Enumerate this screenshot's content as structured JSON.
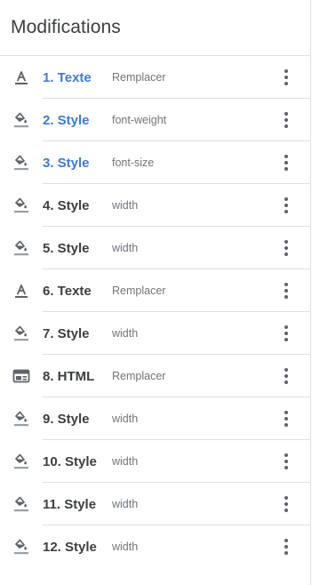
{
  "header": {
    "title": "Modifications"
  },
  "items": [
    {
      "label": "1. Texte",
      "detail": "Remplacer",
      "icon": "text-format-icon",
      "selected": true
    },
    {
      "label": "2. Style",
      "detail": "font-weight",
      "icon": "paint-bucket-icon",
      "selected": true
    },
    {
      "label": "3. Style",
      "detail": "font-size",
      "icon": "paint-bucket-icon",
      "selected": true
    },
    {
      "label": "4. Style",
      "detail": "width",
      "icon": "paint-bucket-icon",
      "selected": false
    },
    {
      "label": "5. Style",
      "detail": "width",
      "icon": "paint-bucket-icon",
      "selected": false
    },
    {
      "label": "6. Texte",
      "detail": "Remplacer",
      "icon": "text-format-icon",
      "selected": false
    },
    {
      "label": "7. Style",
      "detail": "width",
      "icon": "paint-bucket-icon",
      "selected": false
    },
    {
      "label": "8. HTML",
      "detail": "Remplacer",
      "icon": "html-block-icon",
      "selected": false
    },
    {
      "label": "9. Style",
      "detail": "width",
      "icon": "paint-bucket-icon",
      "selected": false
    },
    {
      "label": "10. Style",
      "detail": "width",
      "icon": "paint-bucket-icon",
      "selected": false
    },
    {
      "label": "11. Style",
      "detail": "width",
      "icon": "paint-bucket-icon",
      "selected": false
    },
    {
      "label": "12. Style",
      "detail": "width",
      "icon": "paint-bucket-icon",
      "selected": false
    }
  ],
  "colors": {
    "selected_label": "#3f7ad6",
    "label": "#3c4043",
    "detail": "#70757a",
    "icon": "#5f6368",
    "divider": "#e0e0e0"
  }
}
